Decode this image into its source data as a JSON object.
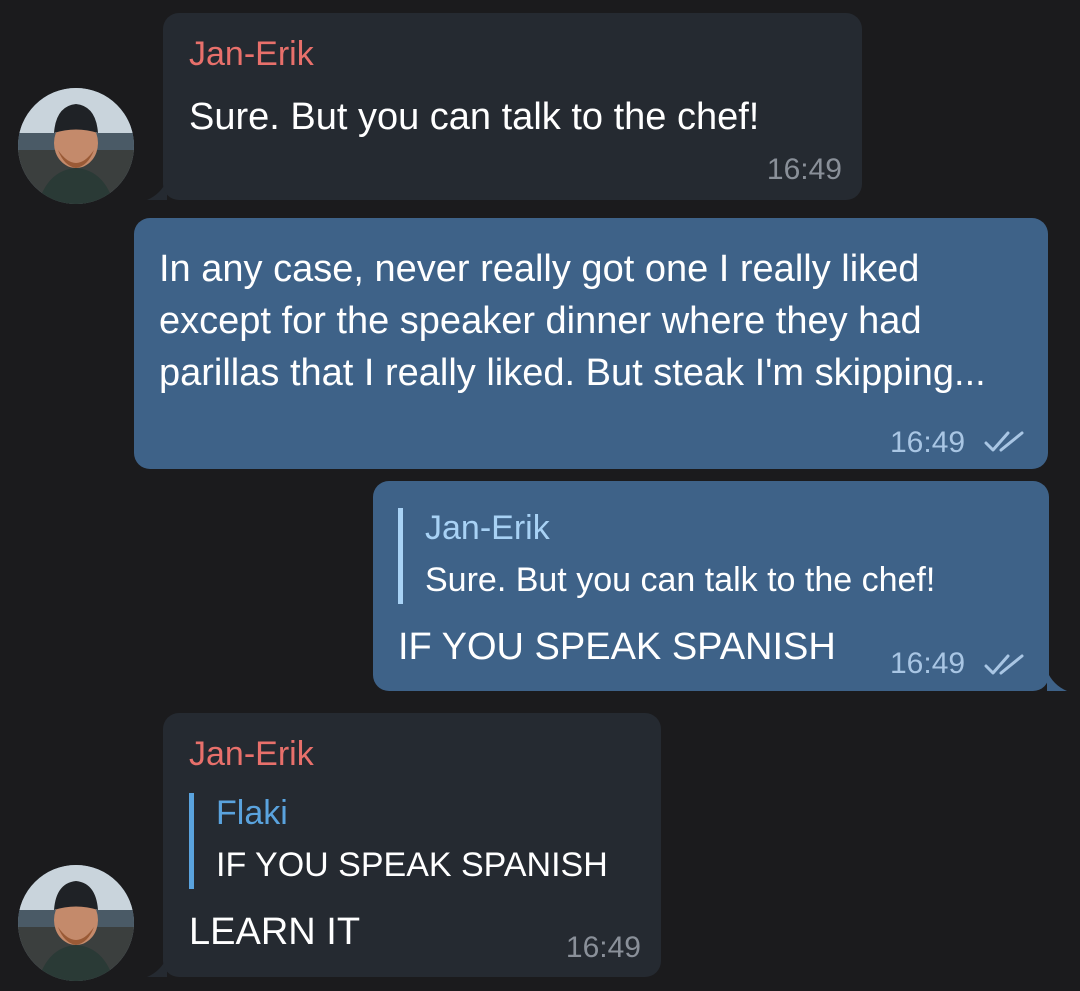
{
  "messages": [
    {
      "direction": "incoming",
      "sender": "Jan-Erik",
      "text": "Sure. But you can talk to the chef!",
      "time": "16:49"
    },
    {
      "direction": "outgoing",
      "text": "In any case, never really got one I really liked except for the speaker dinner where they had parillas that I really liked. But steak I'm skipping...",
      "time": "16:49",
      "status": "read"
    },
    {
      "direction": "outgoing",
      "reply_to": {
        "name": "Jan-Erik",
        "text": "Sure. But you can talk to the chef!"
      },
      "text": "IF YOU SPEAK SPANISH",
      "time": "16:49",
      "status": "read"
    },
    {
      "direction": "incoming",
      "sender": "Jan-Erik",
      "reply_to": {
        "name": "Flaki",
        "text": "IF YOU SPEAK SPANISH"
      },
      "text": "LEARN IT",
      "time": "16:49"
    }
  ],
  "colors": {
    "background": "#1b1b1d",
    "incoming_bubble": "#252a31",
    "outgoing_bubble": "#3e6288",
    "sender_name": "#e8706b",
    "reply_accent_outgoing": "#a8d2f5",
    "reply_accent_incoming": "#5aa3de",
    "read_ticks": "#a9c6e4"
  },
  "icons": {
    "avatar": "user-avatar-photo",
    "read_status": "double-check-icon"
  }
}
